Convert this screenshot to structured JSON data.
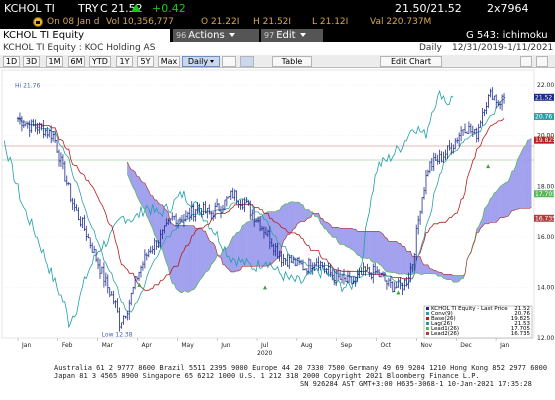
{
  "ticker_bar": {
    "ticker": "KCHOL TI",
    "currency": "TRY",
    "price": "C 21.52",
    "change": "+0.42",
    "bid_ask": "21.50/21.52",
    "size": "2x7964"
  },
  "stats_bar": {
    "date": "On 08 Jan d",
    "volume": "Vol 10,356,777",
    "open": "O 21.22I",
    "high": "H 21.52I",
    "low": "L 21.12I",
    "value": "Val 220.737M"
  },
  "title_bar": {
    "security": "KCHOL TI Equity",
    "actions_num": "96",
    "actions_label": "Actions",
    "edit_num": "97",
    "edit_label": "Edit",
    "graph_title": "G 543: ichimoku"
  },
  "sub_header": {
    "name": "KCHOL TI Equity : KOC Holding AS",
    "frequency": "Daily",
    "range": "12/31/2019-1/11/2021"
  },
  "toolbar": {
    "buttons": [
      "1D",
      "3D",
      "1M",
      "6M",
      "YTD",
      "1Y",
      "5Y",
      "Max"
    ],
    "period": "Daily",
    "table": "Table",
    "edit_chart": "Edit Chart"
  },
  "colors": {
    "price": "#1c2c8c",
    "conversion": "#2fa0a6",
    "base": "#b81c1c",
    "lagging": "#1fa0a8",
    "lead1": "#56b856",
    "lead2": "#b04040",
    "cloud_bull": "#9a9aee",
    "cloud_bear": "#9a9aee",
    "up_arrow": "#3aa03a"
  },
  "chart_data": {
    "type": "line",
    "y_axis_ticks": [
      "22.00",
      "20.00",
      "18.00",
      "16.00",
      "14.00",
      "12.00"
    ],
    "x_axis_labels": [
      "Jan",
      "Feb",
      "Mar",
      "Apr",
      "May",
      "Jun",
      "Jul",
      "Aug",
      "Sep",
      "Oct",
      "Nov",
      "Dec",
      "Jan"
    ],
    "year_label": "2020",
    "high_annotation": "Hi 21.76",
    "low_annotation": "Low 12.38",
    "price_tags": [
      "21.52",
      "20.76",
      "19.825",
      "17.705",
      "16.735"
    ],
    "legend": [
      {
        "name": "KCHOL TI Equity - Last Price",
        "value": "21.52"
      },
      {
        "name": "Conv(9)",
        "value": "20.76"
      },
      {
        "name": "Base(26)",
        "value": "19.825"
      },
      {
        "name": "Lag(26)",
        "value": "21.53"
      },
      {
        "name": "Lead1(26)",
        "value": "17.705"
      },
      {
        "name": "Lead2(26)",
        "value": "16.735"
      }
    ],
    "ylim": [
      12,
      22.6
    ],
    "price_monthly_approx": [
      {
        "x": "Jan",
        "y": 20.6
      },
      {
        "x": "Feb",
        "y": 17.8
      },
      {
        "x": "Mar",
        "y": 13.5
      },
      {
        "x": "Apr",
        "y": 16.2
      },
      {
        "x": "May",
        "y": 17.6
      },
      {
        "x": "Jun",
        "y": 17.8
      },
      {
        "x": "Jul",
        "y": 17.9
      },
      {
        "x": "Aug",
        "y": 14.8
      },
      {
        "x": "Sep",
        "y": 14.2
      },
      {
        "x": "Oct",
        "y": 14.6
      },
      {
        "x": "Nov",
        "y": 18.9
      },
      {
        "x": "Dec",
        "y": 20.5
      },
      {
        "x": "Jan",
        "y": 21.52
      }
    ]
  },
  "footer": {
    "line1": "Australia 61 2 9777 8600 Brazil 5511 2395 9000 Europe 44 20 7330 7500 Germany 49 69 9204 1210 Hong Kong 852 2977 6000",
    "line2": "Japan 81 3 4565 8900          Singapore 65 6212 1000          U.S. 1 212 318 2000          Copyright 2021 Bloomberg Finance L.P.",
    "line3": "SN 926284 AST  GMT+3:00 H635-3068-1 10-Jan-2021 17:35:28"
  }
}
